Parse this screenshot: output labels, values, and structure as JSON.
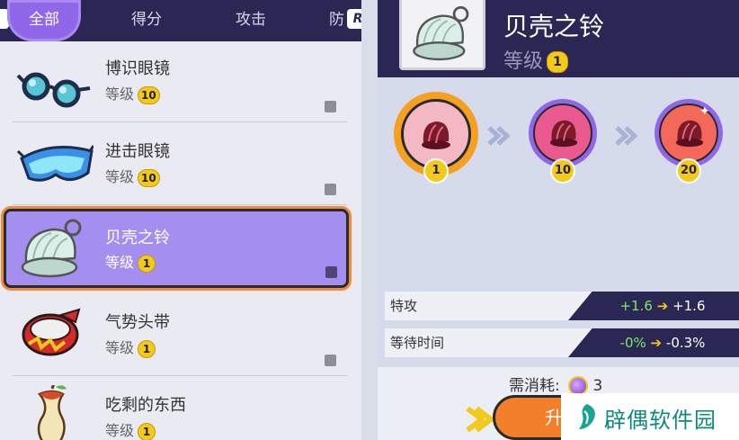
{
  "tabs": {
    "items": [
      {
        "label": "全部",
        "active": true
      },
      {
        "label": "得分",
        "active": false
      },
      {
        "label": "攻击",
        "active": false
      },
      {
        "label": "防",
        "active": false
      }
    ],
    "r_icon_label": "R"
  },
  "item_list": [
    {
      "name": "博识眼镜",
      "level_label": "等级",
      "level": "10",
      "icon": "wise-glasses-icon"
    },
    {
      "name": "进击眼镜",
      "level_label": "等级",
      "level": "10",
      "icon": "choice-specs-icon"
    },
    {
      "name": "贝壳之铃",
      "level_label": "等级",
      "level": "1",
      "icon": "shell-bell-icon",
      "selected": true
    },
    {
      "name": "气势头带",
      "level_label": "等级",
      "level": "1",
      "icon": "muscle-band-icon"
    },
    {
      "name": "吃剩的东西",
      "level_label": "等级",
      "level": "1",
      "icon": "leftovers-icon"
    }
  ],
  "detail": {
    "title": "贝壳之铃",
    "level_label": "等级",
    "level": "1",
    "stages": [
      "1",
      "10",
      "20"
    ],
    "stats": [
      {
        "label": "特攻",
        "from": "+1.6",
        "to": "+1.6"
      },
      {
        "label": "等待时间",
        "from": "-0%",
        "to": "-0.3%"
      }
    ],
    "cost_label": "需消耗:",
    "cost_value": "3",
    "upgrade_label": "升"
  },
  "watermark": {
    "text": "辟偶软件园"
  },
  "colors": {
    "accent_purple": "#8f67e8",
    "header_navy": "#2a2754",
    "badge_yellow": "#f3c91b",
    "highlight_orange": "#f08a3e",
    "stat_green": "#7de86a"
  }
}
